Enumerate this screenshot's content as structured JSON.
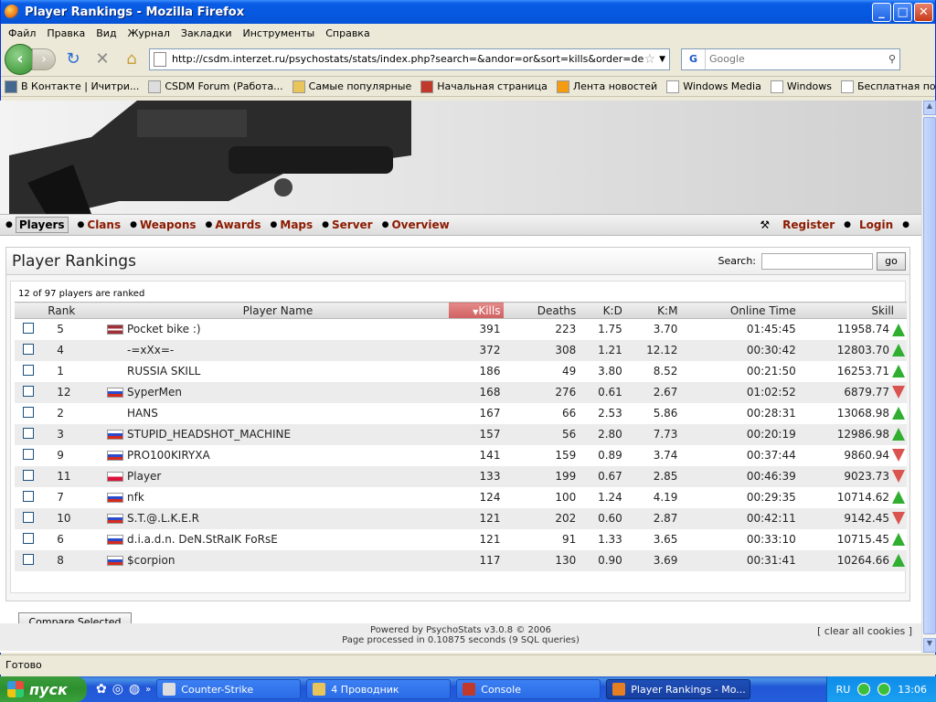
{
  "window": {
    "title": "Player Rankings - Mozilla Firefox"
  },
  "menu": [
    "Файл",
    "Правка",
    "Вид",
    "Журнал",
    "Закладки",
    "Инструменты",
    "Справка"
  ],
  "url": "http://csdm.interzet.ru/psychostats/stats/index.php?search=&andor=or&sort=kills&order=desc",
  "search": {
    "placeholder": "Google"
  },
  "bookmarks": [
    "В Контакте | Ичитри...",
    "CSDM Forum (Работа...",
    "Самые популярные",
    "Начальная страница",
    "Лента новостей",
    "Windows Media",
    "Windows",
    "Бесплатная почта Н..."
  ],
  "nav": {
    "items": [
      "Players",
      "Clans",
      "Weapons",
      "Awards",
      "Maps",
      "Server",
      "Overview"
    ],
    "register": "Register",
    "login": "Login"
  },
  "page": {
    "title": "Player Rankings",
    "search_label": "Search:",
    "go_label": "go",
    "count_text": "12 of 97 players are ranked",
    "compare_label": "Compare Selected"
  },
  "table": {
    "headers": {
      "rank": "Rank",
      "name": "Player Name",
      "kills": "Kills",
      "deaths": "Deaths",
      "kd": "K:D",
      "km": "K:M",
      "time": "Online Time",
      "skill": "Skill"
    },
    "rows": [
      {
        "rank": "5",
        "flag": "lv",
        "name": "Pocket bike :)",
        "kills": "391",
        "deaths": "223",
        "kd": "1.75",
        "km": "3.70",
        "time": "01:45:45",
        "skill": "11958.74",
        "trend": "up"
      },
      {
        "rank": "4",
        "flag": "",
        "name": "-=xXx=-",
        "kills": "372",
        "deaths": "308",
        "kd": "1.21",
        "km": "12.12",
        "time": "00:30:42",
        "skill": "12803.70",
        "trend": "up"
      },
      {
        "rank": "1",
        "flag": "",
        "name": "RUSSIA SKILL",
        "kills": "186",
        "deaths": "49",
        "kd": "3.80",
        "km": "8.52",
        "time": "00:21:50",
        "skill": "16253.71",
        "trend": "up"
      },
      {
        "rank": "12",
        "flag": "ru",
        "name": "SyperMen",
        "kills": "168",
        "deaths": "276",
        "kd": "0.61",
        "km": "2.67",
        "time": "01:02:52",
        "skill": "6879.77",
        "trend": "down"
      },
      {
        "rank": "2",
        "flag": "",
        "name": "HANS",
        "kills": "167",
        "deaths": "66",
        "kd": "2.53",
        "km": "5.86",
        "time": "00:28:31",
        "skill": "13068.98",
        "trend": "up"
      },
      {
        "rank": "3",
        "flag": "ru",
        "name": "STUPID_HEADSHOT_MACHINE",
        "kills": "157",
        "deaths": "56",
        "kd": "2.80",
        "km": "7.73",
        "time": "00:20:19",
        "skill": "12986.98",
        "trend": "up"
      },
      {
        "rank": "9",
        "flag": "ru",
        "name": "PRO100KIRYXA",
        "kills": "141",
        "deaths": "159",
        "kd": "0.89",
        "km": "3.74",
        "time": "00:37:44",
        "skill": "9860.94",
        "trend": "down"
      },
      {
        "rank": "11",
        "flag": "pl",
        "name": "Player",
        "kills": "133",
        "deaths": "199",
        "kd": "0.67",
        "km": "2.85",
        "time": "00:46:39",
        "skill": "9023.73",
        "trend": "down"
      },
      {
        "rank": "7",
        "flag": "ru",
        "name": "nfk",
        "kills": "124",
        "deaths": "100",
        "kd": "1.24",
        "km": "4.19",
        "time": "00:29:35",
        "skill": "10714.62",
        "trend": "up"
      },
      {
        "rank": "10",
        "flag": "ru",
        "name": "S.T.@.L.K.E.R",
        "kills": "121",
        "deaths": "202",
        "kd": "0.60",
        "km": "2.87",
        "time": "00:42:11",
        "skill": "9142.45",
        "trend": "down"
      },
      {
        "rank": "6",
        "flag": "ru",
        "name": "d.i.a.d.n. DeN.StRaIK FoRsE",
        "kills": "121",
        "deaths": "91",
        "kd": "1.33",
        "km": "3.65",
        "time": "00:33:10",
        "skill": "10715.45",
        "trend": "up"
      },
      {
        "rank": "8",
        "flag": "ru",
        "name": "$corpion",
        "kills": "117",
        "deaths": "130",
        "kd": "0.90",
        "km": "3.69",
        "time": "00:31:41",
        "skill": "10264.66",
        "trend": "up"
      }
    ]
  },
  "footer": {
    "line1": "Powered by PsychoStats v3.0.8 © 2006",
    "line2": "Page processed in 0.10875 seconds (9 SQL queries)",
    "clear": "[ clear all cookies ]"
  },
  "status": "Готово",
  "taskbar": {
    "start": "пуск",
    "tasks": [
      "Counter-Strike",
      "4 Проводник",
      "Console",
      "Player Rankings - Mo..."
    ],
    "lang": "RU",
    "clock": "13:06"
  }
}
